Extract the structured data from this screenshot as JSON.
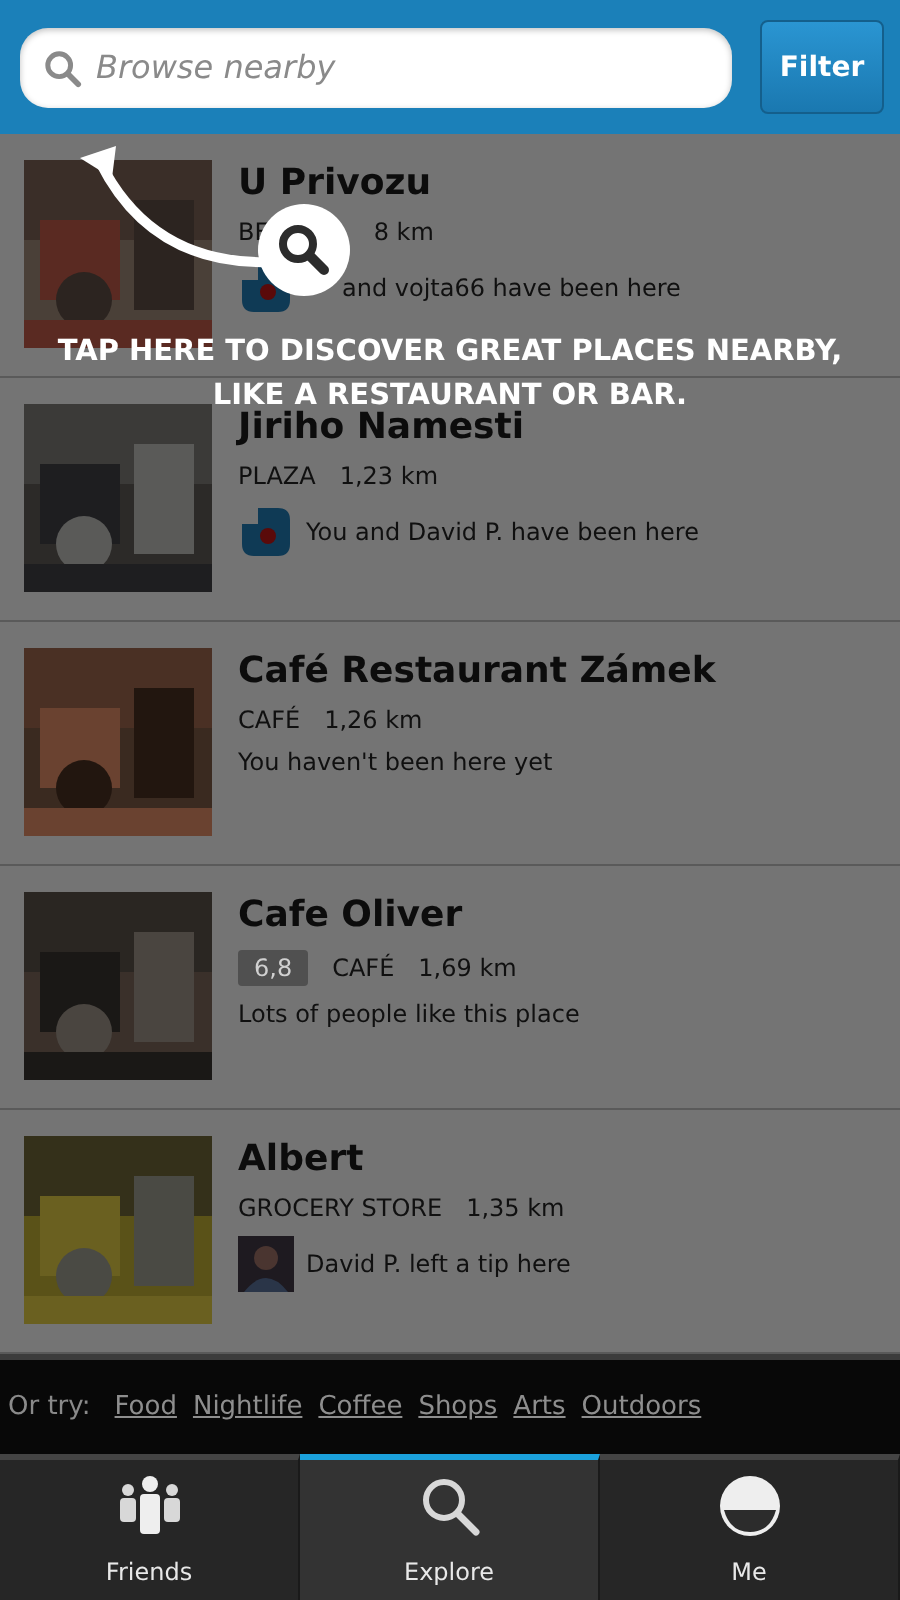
{
  "search": {
    "placeholder": "Browse nearby"
  },
  "filter_button": "Filter",
  "places": [
    {
      "title": "U Privozu",
      "category": "BE",
      "distance": "8 km",
      "activity": {
        "kind": "app",
        "text": "and vojta66 have been here"
      }
    },
    {
      "title": "Jiriho Namesti",
      "category": "PLAZA",
      "distance": "1,23 km",
      "activity": {
        "kind": "app",
        "text": "You and David P. have been here"
      }
    },
    {
      "title": "Café Restaurant Zámek",
      "category": "CAFÉ",
      "distance": "1,26 km",
      "activity": {
        "kind": "plain",
        "text": "You haven't been here yet"
      }
    },
    {
      "title": "Cafe Oliver",
      "rating": "6,8",
      "category": "CAFÉ",
      "distance": "1,69 km",
      "activity": {
        "kind": "plain",
        "text": "Lots of people like this place"
      }
    },
    {
      "title": "Albert",
      "category": "GROCERY STORE",
      "distance": "1,35 km",
      "activity": {
        "kind": "person",
        "text": "David P. left a tip here"
      }
    }
  ],
  "coach_mark": {
    "text": "TAP HERE TO DISCOVER GREAT PLACES NEARBY, LIKE A RESTAURANT OR BAR."
  },
  "or_try": {
    "label": "Or try:",
    "links": [
      "Food",
      "Nightlife",
      "Coffee",
      "Shops",
      "Arts",
      "Outdoors"
    ]
  },
  "tabs": [
    {
      "label": "Friends",
      "kind": "friends",
      "selected": false
    },
    {
      "label": "Explore",
      "kind": "explore",
      "selected": true
    },
    {
      "label": "Me",
      "kind": "me",
      "selected": false
    }
  ]
}
